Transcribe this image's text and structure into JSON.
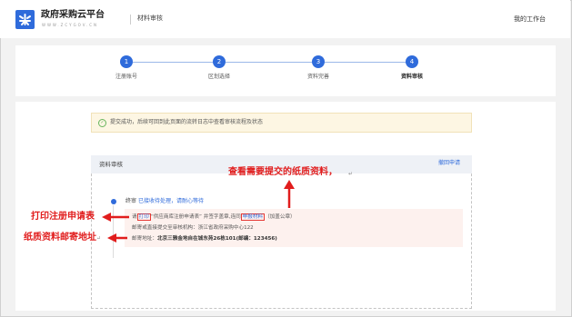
{
  "header": {
    "brand": "政府采购云平台",
    "brand_sub": "WWW.ZCYGOV.CN",
    "section_title": "材料审核",
    "workbench": "我的工作台"
  },
  "steps": [
    {
      "num": "1",
      "label": "注册账号"
    },
    {
      "num": "2",
      "label": "区划选择"
    },
    {
      "num": "3",
      "label": "资料完善"
    },
    {
      "num": "4",
      "label": "资料审核"
    }
  ],
  "success_message": "提交成功，后续可回到此页面的流转日志中查看审核流程及状态",
  "review": {
    "title": "资料审核",
    "withdraw": "撤回申请",
    "status_label": "终审",
    "status_value": "已接收待处理，请耐心等待",
    "instr1_pre": "请",
    "instr1_print": "打印",
    "instr1_mid": "“供应商库注册申请表” 并签字盖章,连同",
    "instr1_material": "申报材料",
    "instr1_post": "（加盖公章）",
    "instr2": "邮寄或直接提交至审核机构：浙江省政府采购中心122",
    "instr3_label": "邮寄地址：",
    "instr3_value": "北京三雅金地自在城东苑26栋101(邮编：123456)"
  },
  "annotations": {
    "top": "查看需要提交的纸质资料，",
    "top_mark": "↵",
    "left1": "打印注册申请表",
    "left2": "纸质资料邮寄地址",
    "left2_mark": "↵"
  },
  "colors": {
    "accent": "#2f6bdb",
    "annotation": "#e11d1d"
  }
}
